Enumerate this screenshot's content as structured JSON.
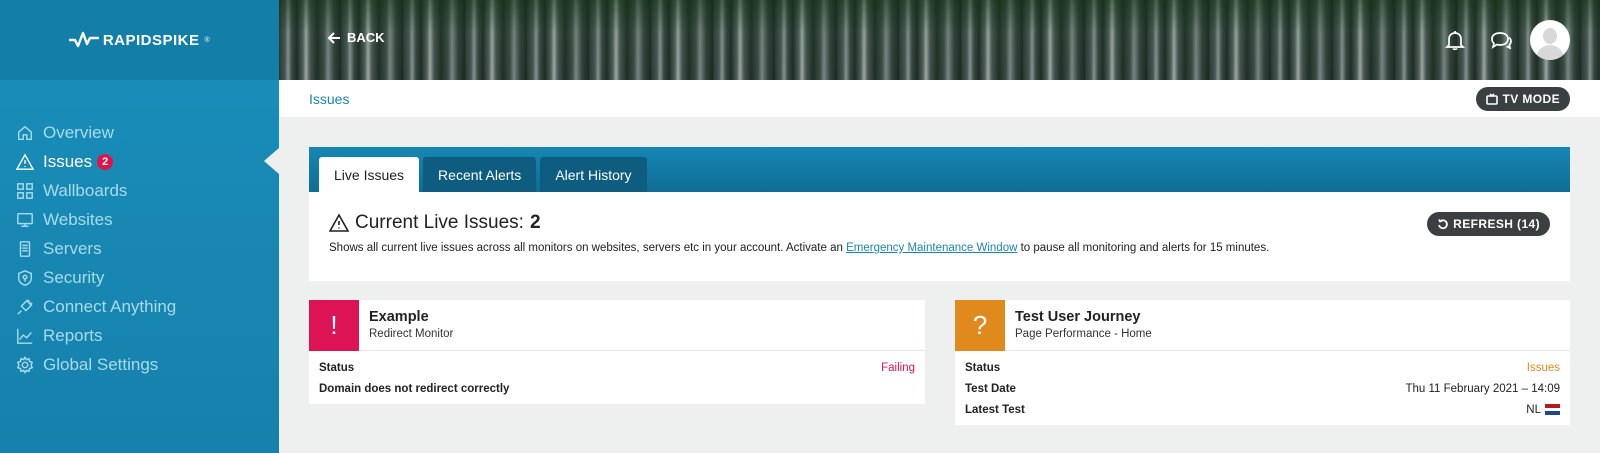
{
  "brand": {
    "name": "RAPIDSPIKE",
    "trademark": "®"
  },
  "sidebar": {
    "items": [
      {
        "label": "Overview",
        "icon": "home-icon"
      },
      {
        "label": "Issues",
        "icon": "warning-icon",
        "badge": "2",
        "active": true
      },
      {
        "label": "Wallboards",
        "icon": "grid-icon"
      },
      {
        "label": "Websites",
        "icon": "monitor-icon"
      },
      {
        "label": "Servers",
        "icon": "server-icon"
      },
      {
        "label": "Security",
        "icon": "shield-icon"
      },
      {
        "label": "Connect Anything",
        "icon": "plug-icon"
      },
      {
        "label": "Reports",
        "icon": "chart-icon"
      },
      {
        "label": "Global Settings",
        "icon": "gear-icon"
      }
    ]
  },
  "header": {
    "back_label": "BACK",
    "icons": [
      "bell-icon",
      "chat-icon"
    ],
    "avatar": "user-avatar"
  },
  "breadcrumb": {
    "current": "Issues"
  },
  "tv_mode": {
    "label": "TV MODE"
  },
  "tabs": [
    {
      "label": "Live Issues",
      "active": true
    },
    {
      "label": "Recent Alerts"
    },
    {
      "label": "Alert History"
    }
  ],
  "live": {
    "title": "Current Live Issues:",
    "count": "2",
    "desc_before": "Shows all current live issues across all monitors on websites, servers etc in your account. Activate an ",
    "link": "Emergency Maintenance Window",
    "desc_after": " to pause all monitoring and alerts for 15 minutes.",
    "refresh_label": "REFRESH (14)"
  },
  "cards": [
    {
      "symbol": "!",
      "color": "#dc1455",
      "title": "Example",
      "subtitle": "Redirect Monitor",
      "status_label": "Status",
      "status_value": "Failing",
      "status_color": "#dc1455",
      "detail": "Domain does not redirect correctly"
    },
    {
      "symbol": "?",
      "color": "#e08a1e",
      "title": "Test User Journey",
      "subtitle": "Page Performance - Home",
      "status_label": "Status",
      "status_value": "Issues",
      "status_color": "#e08a1e",
      "date_label": "Test Date",
      "date_value": "Thu 11 February 2021 – 14:09",
      "latest_label": "Latest Test",
      "latest_value": "NL"
    }
  ],
  "colors": {
    "sidebar": "#1a8fba",
    "accent": "#1a86b0",
    "failing": "#dc1455",
    "warning": "#e08a1e",
    "dark_button": "#3a3f42"
  }
}
